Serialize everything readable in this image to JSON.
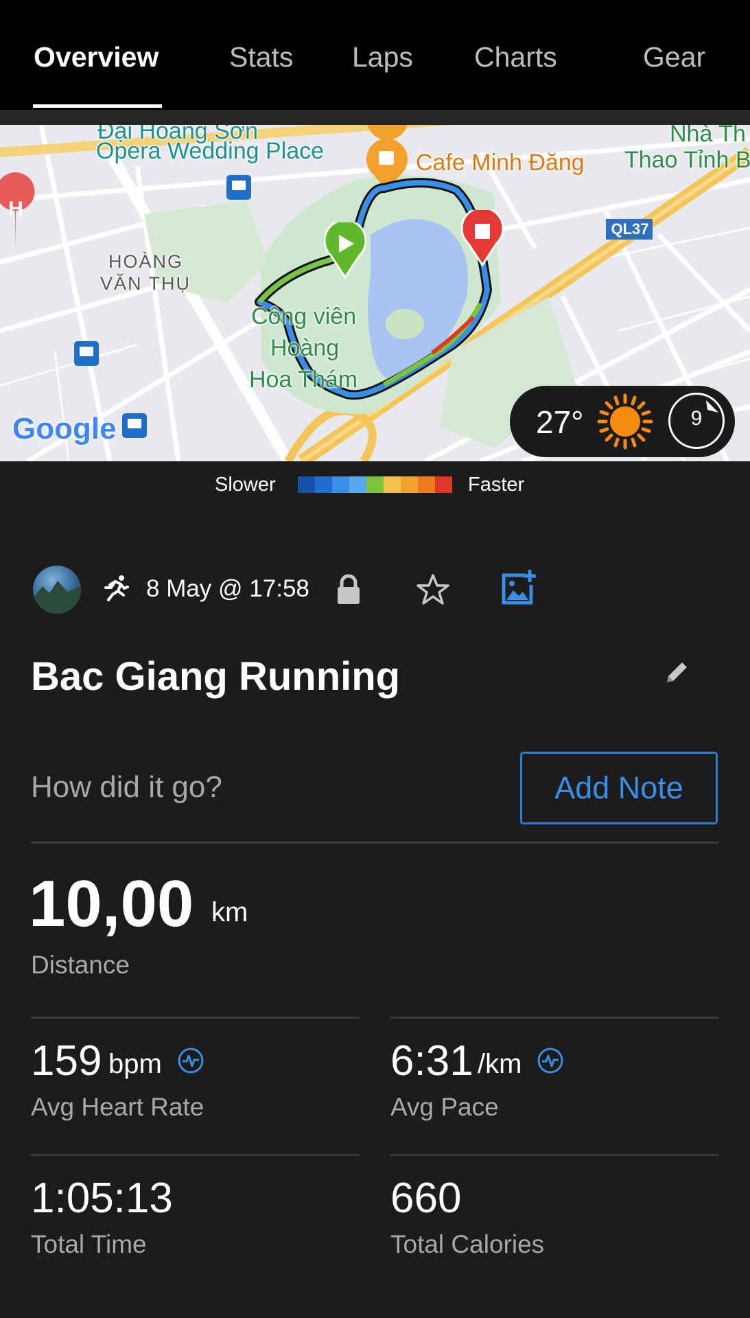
{
  "tabs": [
    {
      "label": "Overview",
      "active": true
    },
    {
      "label": "Stats",
      "active": false
    },
    {
      "label": "Laps",
      "active": false
    },
    {
      "label": "Charts",
      "active": false
    },
    {
      "label": "Gear",
      "active": false
    }
  ],
  "map": {
    "labels": {
      "opera_top": "Đại Hoàng Sơn",
      "opera": "Opera Wedding Place",
      "cafe": "Cafe Minh Đăng",
      "nha_top": "Nhà Th",
      "thao": "Thao Tỉnh B",
      "road": "QL37",
      "district_1": "HOÀNG",
      "district_2": "VĂN THỤ",
      "park_1": "Công viên",
      "park_2": "Hoàng",
      "park_3": "Hoa Thám",
      "google": "Google"
    },
    "icons": [
      "hospital-icon",
      "bus-stop-icon",
      "cafe-icon",
      "start-flag-icon",
      "stop-flag-icon"
    ]
  },
  "weather": {
    "temperature": "27°",
    "condition_icon": "sun-icon",
    "wind": "9"
  },
  "legend": {
    "slower": "Slower",
    "faster": "Faster",
    "colors": [
      "#1451a8",
      "#1f6fd0",
      "#3a8ee6",
      "#58a8ef",
      "#7cc53a",
      "#f0c44a",
      "#f4a02c",
      "#ec7a1e",
      "#e03828"
    ]
  },
  "activity": {
    "type_icon": "running-icon",
    "date": "8 May @ 17:58",
    "title": "Bac Giang Running",
    "note_prompt": "How did it go?",
    "add_note_label": "Add Note"
  },
  "stats": {
    "distance": {
      "value": "10,00",
      "unit": "km",
      "label": "Distance"
    },
    "heart_rate": {
      "value": "159",
      "unit": "bpm",
      "label": "Avg Heart Rate"
    },
    "pace": {
      "value": "6:31",
      "unit": "/km",
      "label": "Avg Pace"
    },
    "time": {
      "value": "1:05:13",
      "label": "Total Time"
    },
    "calories": {
      "value": "660",
      "label": "Total Calories"
    }
  },
  "colors": {
    "accent": "#3a8ee6",
    "background": "#1c1c1c",
    "header": "#000000"
  }
}
